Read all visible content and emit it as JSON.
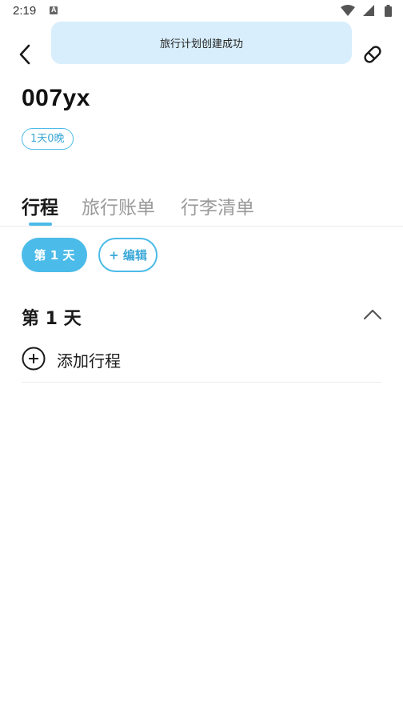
{
  "status_bar": {
    "time": "2:19",
    "notification_icon": "a-badge-icon",
    "wifi_icon": "wifi-icon",
    "signal_icon": "signal-icon",
    "battery_icon": "battery-icon"
  },
  "toast": {
    "message": "旅行计划创建成功"
  },
  "header": {
    "back_icon": "chevron-left-icon",
    "edit_icon": "eraser-icon"
  },
  "trip": {
    "title": "007yx",
    "duration": "1天0晚"
  },
  "tabs": [
    {
      "label": "行程",
      "active": true
    },
    {
      "label": "旅行账单",
      "active": false
    },
    {
      "label": "行李清单",
      "active": false
    }
  ],
  "day_selector": {
    "days": [
      {
        "label": "第 1 天",
        "selected": true
      }
    ],
    "edit_label": "+ 编辑"
  },
  "day_section": {
    "title": "第 1 天",
    "collapse_icon": "chevron-up-icon",
    "add_label": "添加行程",
    "add_icon": "plus-circle-icon"
  },
  "colors": {
    "accent": "#4bbbe9",
    "toast_bg": "#d8eefc",
    "text_primary": "#1a1a1a",
    "text_secondary": "#9a9a9a"
  }
}
